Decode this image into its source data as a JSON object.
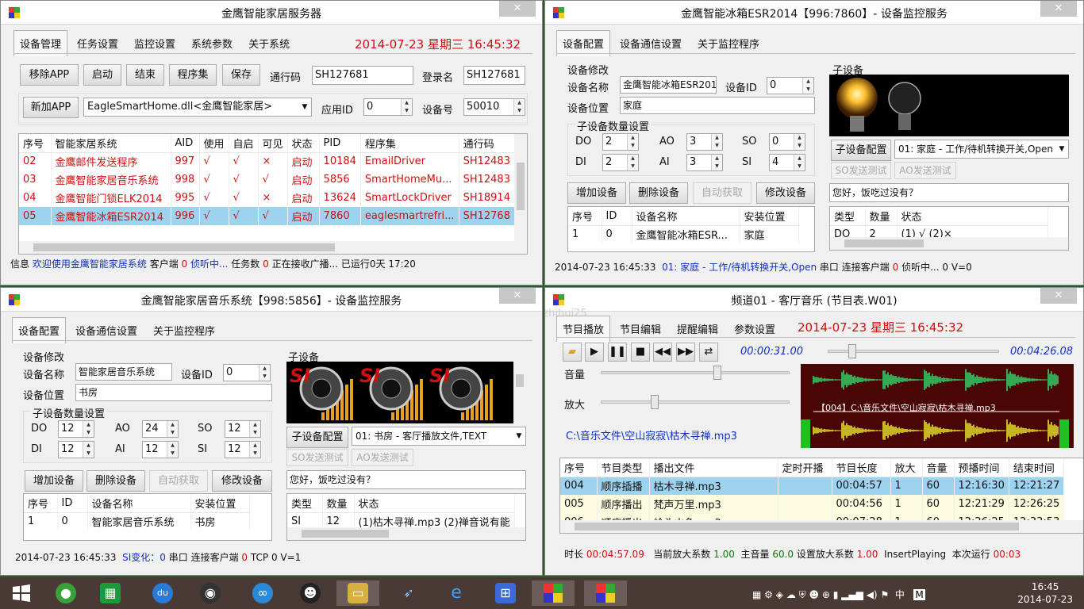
{
  "colors": {
    "accent_red": "#cc1010",
    "selection": "#9dd3ee",
    "desktop": "#2a5a2a",
    "taskbar": "#4a3a36"
  },
  "w1": {
    "title": "金鹰智能家居服务器",
    "tabs": [
      "设备管理",
      "任务设置",
      "监控设置",
      "系统参数",
      "关于系统"
    ],
    "clock": "2014-07-23  星期三   16:45:32",
    "buttons": {
      "remove_app": "移除APP",
      "start": "启动",
      "stop": "结束",
      "assembly": "程序集",
      "save": "保存",
      "add_app": "新加APP"
    },
    "labels": {
      "passcode": "通行码",
      "login": "登录名",
      "app_id": "应用ID",
      "device_no": "设备号"
    },
    "inputs": {
      "passcode": "SH127681",
      "login": "SH127681",
      "app_id": "0",
      "device_no": "50010"
    },
    "dll_select": "EagleSmartHome.dll<金鹰智能家居>",
    "table": {
      "headers": [
        "序号",
        "智能家居系统",
        "AID",
        "使用",
        "自启",
        "可见",
        "状态",
        "PID",
        "程序集",
        "通行码"
      ],
      "rows": [
        [
          "02",
          "金鹰邮件发送程序",
          "997",
          "√",
          "√",
          "×",
          "启动",
          "10184",
          "EmailDriver",
          "SH12483"
        ],
        [
          "03",
          "金鹰智能家居音乐系统",
          "998",
          "√",
          "√",
          "√",
          "启动",
          "5856",
          "SmartHomeMu...",
          "SH12483"
        ],
        [
          "04",
          "金鹰智能门锁ELK2014",
          "995",
          "√",
          "√",
          "×",
          "启动",
          "13624",
          "SmartLockDriver",
          "SH18914"
        ],
        [
          "05",
          "金鹰智能冰箱ESR2014",
          "996",
          "√",
          "√",
          "√",
          "启动",
          "7860",
          "eaglesmartrefri...",
          "SH12768"
        ]
      ]
    },
    "status": {
      "info_label": "信息",
      "welcome": "欢迎使用金鹰智能家居系统",
      "clients_label": "客户端",
      "clients": "0",
      "listening": "侦听中...",
      "tasks_label": "任务数",
      "tasks": "0",
      "receiving": "正在接收广播...",
      "uptime": "已运行0天 17:20"
    }
  },
  "w2": {
    "title": "金鹰智能冰箱ESR2014【996:7860】- 设备监控服务",
    "tabs": [
      "设备配置",
      "设备通信设置",
      "关于监控程序"
    ],
    "group_modify": "设备修改",
    "labels": {
      "device_name": "设备名称",
      "device_id": "设备ID",
      "location": "设备位置",
      "sub_count": "子设备数量设置",
      "sub_device": "子设备"
    },
    "inputs": {
      "device_name": "金鹰智能冰箱ESR201",
      "device_id": "0",
      "location": "家庭"
    },
    "counts": [
      {
        "k": "DO",
        "v": "2"
      },
      {
        "k": "AO",
        "v": "3"
      },
      {
        "k": "SO",
        "v": "0"
      },
      {
        "k": "DI",
        "v": "2"
      },
      {
        "k": "AI",
        "v": "3"
      },
      {
        "k": "SI",
        "v": "4"
      }
    ],
    "buttons": {
      "add": "增加设备",
      "delete": "删除设备",
      "auto": "自动获取",
      "modify": "修改设备",
      "sub_cfg": "子设备配置",
      "so_test": "SO发送测试",
      "ao_test": "AO发送测试"
    },
    "sub_select": "01: 家庭 - 工作/待机转换开关,Open",
    "message": "您好，饭吃过没有？",
    "table": {
      "headers": [
        "序号",
        "ID",
        "设备名称",
        "安装位置"
      ],
      "rows": [
        [
          "1",
          "0",
          "金鹰智能冰箱ESR...",
          "家庭"
        ]
      ]
    },
    "sub_table": {
      "headers": [
        "类型",
        "数量",
        "状态"
      ],
      "rows": [
        [
          "DO",
          "2",
          "(1) √ (2)×"
        ]
      ]
    },
    "status": {
      "time": "2014-07-23 16:45:33",
      "sub_info": "01: 家庭 - 工作/待机转换开关,Open",
      "serial": "串口",
      "conn_label": "连接客户端",
      "conn": "0",
      "listening": "侦听中...",
      "zero": "0",
      "v": "V=0"
    }
  },
  "w3": {
    "title": "金鹰智能家居音乐系统【998:5856】- 设备监控服务",
    "tabs": [
      "设备配置",
      "设备通信设置",
      "关于监控程序"
    ],
    "group_modify": "设备修改",
    "labels": {
      "device_name": "设备名称",
      "device_id": "设备ID",
      "location": "设备位置",
      "sub_count": "子设备数量设置",
      "sub_device": "子设备"
    },
    "inputs": {
      "device_name": "智能家居音乐系统",
      "device_id": "0",
      "location": "书房"
    },
    "counts": [
      {
        "k": "DO",
        "v": "12"
      },
      {
        "k": "AO",
        "v": "24"
      },
      {
        "k": "SO",
        "v": "12"
      },
      {
        "k": "DI",
        "v": "12"
      },
      {
        "k": "AI",
        "v": "12"
      },
      {
        "k": "SI",
        "v": "12"
      }
    ],
    "buttons": {
      "add": "增加设备",
      "delete": "删除设备",
      "auto": "自动获取",
      "modify": "修改设备",
      "sub_cfg": "子设备配置",
      "so_test": "SO发送测试",
      "ao_test": "AO发送测试"
    },
    "si_label": "SI",
    "sub_select": "01: 书房 - 客厅播放文件,TEXT",
    "message": "您好，饭吃过没有？",
    "table": {
      "headers": [
        "序号",
        "ID",
        "设备名称",
        "安装位置"
      ],
      "rows": [
        [
          "1",
          "0",
          "智能家居音乐系统",
          "书房"
        ]
      ]
    },
    "sub_table": {
      "headers": [
        "类型",
        "数量",
        "状态"
      ],
      "rows": [
        [
          "SI",
          "12",
          "(1)枯木寻禅.mp3 (2)禅音说有能"
        ]
      ]
    },
    "status": {
      "time": "2014-07-23 16:45:33",
      "si_change": "SI变化：0",
      "serial": "串口",
      "conn_label": "连接客户端",
      "conn": "0",
      "tcp": "TCP",
      "tcp_val": "0",
      "v": "V=1"
    }
  },
  "w4": {
    "title": "频道01 - 客厅音乐 (节目表.W01)",
    "watermark": "http://blog.csdn.net/zuzhihui25",
    "tabs": [
      "节目播放",
      "节目编辑",
      "提醒编辑",
      "参数设置"
    ],
    "clock": "2014-07-23   星期三    16:45:32",
    "elapsed": "00:00:31.00",
    "total": "00:04:26.08",
    "volume_label": "音量",
    "amp_label": "放大",
    "volume_level": 0.62,
    "amp_level": 0.27,
    "progress": 0.12,
    "wave_caption": "【004】C:\\音乐文件\\空山寂寂\\枯木寻禅.mp3",
    "file_path": "C:\\音乐文件\\空山寂寂\\枯木寻禅.mp3",
    "table": {
      "headers": [
        "序号",
        "节目类型",
        "播出文件",
        "定时开播",
        "节目长度",
        "放大",
        "音量",
        "预播时间",
        "结束时间"
      ],
      "rows": [
        [
          "004",
          "顺序插播",
          "  枯木寻禅.mp3",
          "",
          "00:04:57",
          "1",
          "60",
          "12:16:30",
          "12:21:27"
        ],
        [
          "005",
          "顺序播出",
          "梵声万里.mp3",
          "",
          "00:04:56",
          "1",
          "60",
          "12:21:29",
          "12:26:25"
        ],
        [
          "006",
          "顺序播出",
          "岭头山色.mp3",
          "",
          "00:07:28",
          "1",
          "60",
          "12:26:25",
          "12:33:53"
        ]
      ]
    },
    "status": {
      "duration_label": "时长",
      "duration": "00:04:57.09",
      "amp_label": "当前放大系数",
      "amp": "1.00",
      "master_label": "主音量",
      "master": "60.0",
      "set_amp_label": "设置放大系数",
      "set_amp": "1.00",
      "mode": "InsertPlaying",
      "run_label": "本次运行",
      "run": "00:03"
    }
  },
  "taskbar": {
    "tray_lang": "中",
    "tray_ime": "M",
    "time": "16:45",
    "date": "2014-07-23"
  }
}
